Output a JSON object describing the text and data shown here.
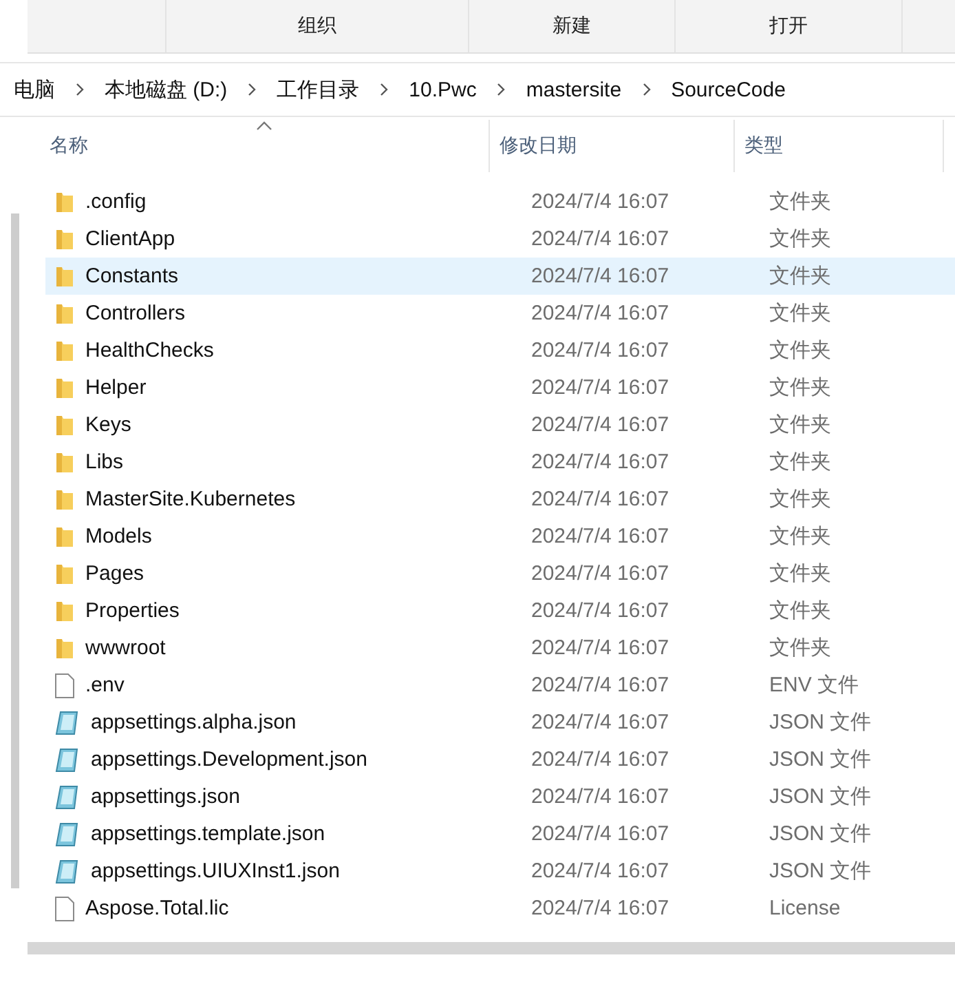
{
  "toolbar": {
    "buttons": [
      "组织",
      "新建",
      "打开"
    ]
  },
  "breadcrumb": [
    "电脑",
    "本地磁盘 (D:)",
    "工作目录",
    "10.Pwc",
    "mastersite",
    "SourceCode"
  ],
  "table": {
    "columns": [
      {
        "label": "名称",
        "sorted": true
      },
      {
        "label": "修改日期",
        "sorted": false
      },
      {
        "label": "类型",
        "sorted": false
      }
    ],
    "rows": [
      {
        "kind": "folder",
        "name": ".config",
        "date": "2024/7/4 16:07",
        "type": "文件夹",
        "selected": false
      },
      {
        "kind": "folder",
        "name": "ClientApp",
        "date": "2024/7/4 16:07",
        "type": "文件夹",
        "selected": false
      },
      {
        "kind": "folder",
        "name": "Constants",
        "date": "2024/7/4 16:07",
        "type": "文件夹",
        "selected": true
      },
      {
        "kind": "folder",
        "name": "Controllers",
        "date": "2024/7/4 16:07",
        "type": "文件夹",
        "selected": false
      },
      {
        "kind": "folder",
        "name": "HealthChecks",
        "date": "2024/7/4 16:07",
        "type": "文件夹",
        "selected": false
      },
      {
        "kind": "folder",
        "name": "Helper",
        "date": "2024/7/4 16:07",
        "type": "文件夹",
        "selected": false
      },
      {
        "kind": "folder",
        "name": "Keys",
        "date": "2024/7/4 16:07",
        "type": "文件夹",
        "selected": false
      },
      {
        "kind": "folder",
        "name": "Libs",
        "date": "2024/7/4 16:07",
        "type": "文件夹",
        "selected": false
      },
      {
        "kind": "folder",
        "name": "MasterSite.Kubernetes",
        "date": "2024/7/4 16:07",
        "type": "文件夹",
        "selected": false
      },
      {
        "kind": "folder",
        "name": "Models",
        "date": "2024/7/4 16:07",
        "type": "文件夹",
        "selected": false
      },
      {
        "kind": "folder",
        "name": "Pages",
        "date": "2024/7/4 16:07",
        "type": "文件夹",
        "selected": false
      },
      {
        "kind": "folder",
        "name": "Properties",
        "date": "2024/7/4 16:07",
        "type": "文件夹",
        "selected": false
      },
      {
        "kind": "folder",
        "name": "wwwroot",
        "date": "2024/7/4 16:07",
        "type": "文件夹",
        "selected": false
      },
      {
        "kind": "file",
        "name": ".env",
        "date": "2024/7/4 16:07",
        "type": "ENV 文件",
        "selected": false
      },
      {
        "kind": "json",
        "name": "appsettings.alpha.json",
        "date": "2024/7/4 16:07",
        "type": "JSON 文件",
        "selected": false
      },
      {
        "kind": "json",
        "name": "appsettings.Development.json",
        "date": "2024/7/4 16:07",
        "type": "JSON 文件",
        "selected": false
      },
      {
        "kind": "json",
        "name": "appsettings.json",
        "date": "2024/7/4 16:07",
        "type": "JSON 文件",
        "selected": false
      },
      {
        "kind": "json",
        "name": "appsettings.template.json",
        "date": "2024/7/4 16:07",
        "type": "JSON 文件",
        "selected": false
      },
      {
        "kind": "json",
        "name": "appsettings.UIUXInst1.json",
        "date": "2024/7/4 16:07",
        "type": "JSON 文件",
        "selected": false
      },
      {
        "kind": "file",
        "name": "Aspose.Total.lic",
        "date": "2024/7/4 16:07",
        "type": "License",
        "selected": false
      }
    ]
  }
}
